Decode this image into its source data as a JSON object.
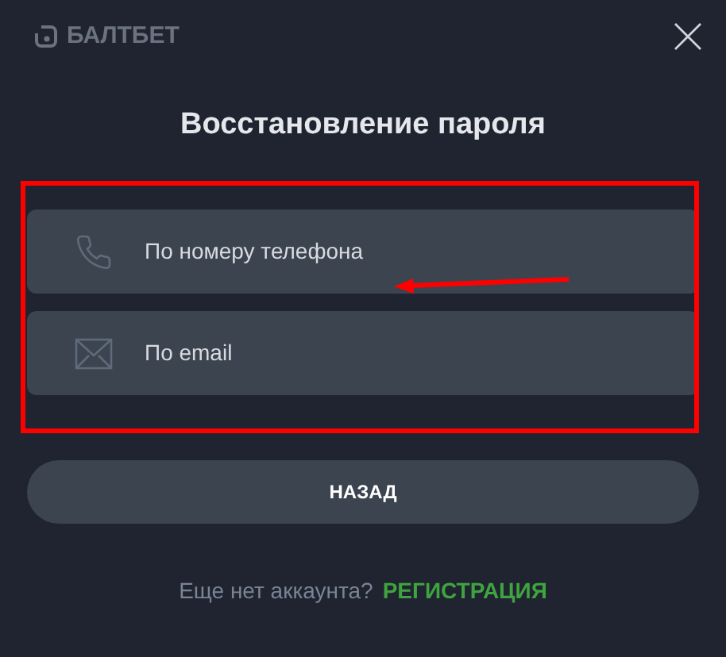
{
  "brand": {
    "name": "БАЛТБЕТ"
  },
  "title": "Восстановление пароля",
  "options": [
    {
      "kind": "phone",
      "label": "По номеру телефона"
    },
    {
      "kind": "email",
      "label": "По email"
    }
  ],
  "back_button": "НАЗАД",
  "footer": {
    "text": "Еще нет аккаунта?",
    "link": "РЕГИСТРАЦИЯ"
  }
}
